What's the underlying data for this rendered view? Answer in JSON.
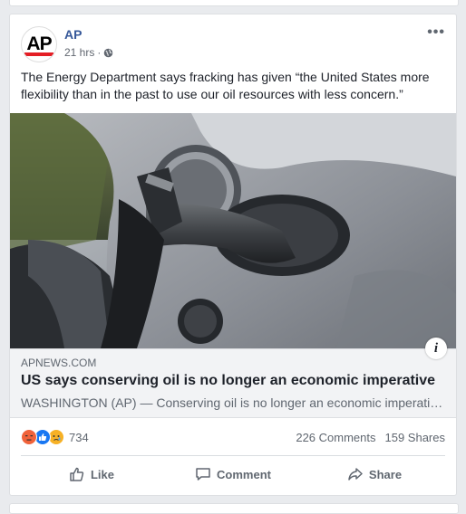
{
  "post": {
    "author": "AP",
    "avatar_logo": "AP",
    "time": "21 hrs",
    "separator": "·",
    "privacy_icon": "globe-icon",
    "more_label": "•••",
    "text": "The Energy Department says fracking has given “the United States more flexibility than in the past to use our oil resources with less concern.”"
  },
  "link": {
    "domain": "APNEWS.COM",
    "headline": "US says conserving oil is no longer an economic imperative",
    "description": "WASHINGTON (AP) — Conserving oil is no longer an economic imperative for the U.S.",
    "info_label": "i"
  },
  "stats": {
    "reaction_icons": [
      "angry-icon",
      "like-icon",
      "sad-icon"
    ],
    "reaction_count": "734",
    "comments": "226 Comments",
    "shares": "159 Shares"
  },
  "actions": {
    "like": "Like",
    "comment": "Comment",
    "share": "Share"
  },
  "colors": {
    "link_name": "#365899",
    "ap_red": "#e41e25",
    "like_blue": "#1877f2",
    "angry_orange": "#f0623a",
    "sad_yellow": "#f7b125"
  }
}
